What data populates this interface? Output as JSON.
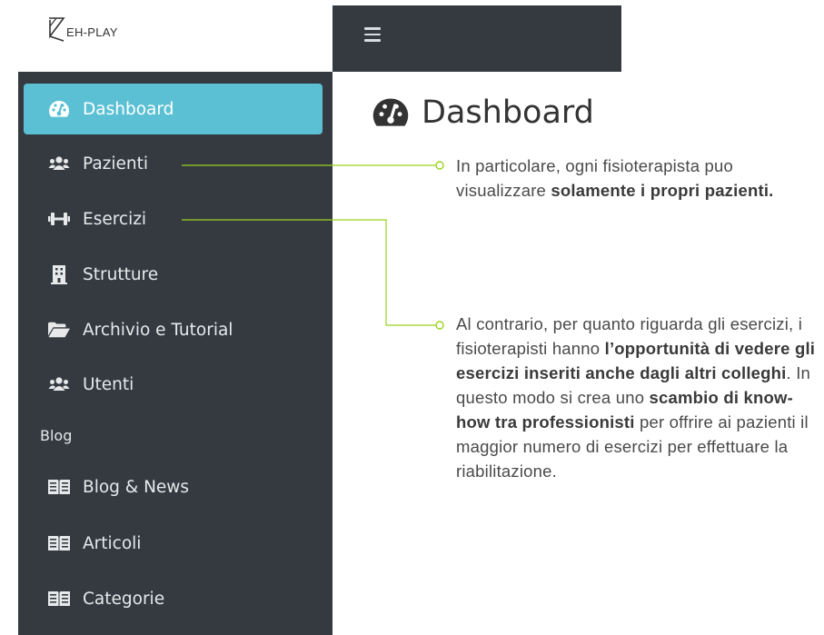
{
  "brand": {
    "logo_text": "EH-PLAY"
  },
  "header": {
    "menu_icon": "hamburger-icon"
  },
  "sidebar": {
    "items": [
      {
        "label": "Dashboard",
        "icon": "dashboard-gauge-icon",
        "active": true
      },
      {
        "label": "Pazienti",
        "icon": "users-icon"
      },
      {
        "label": "Esercizi",
        "icon": "dumbbell-icon"
      },
      {
        "label": "Strutture",
        "icon": "building-icon"
      },
      {
        "label": "Archivio e Tutorial",
        "icon": "folder-open-icon"
      },
      {
        "label": "Utenti",
        "icon": "users-icon"
      }
    ],
    "section_blog": "Blog",
    "blog_items": [
      {
        "label": "Blog & News",
        "icon": "book-open-icon"
      },
      {
        "label": "Articoli",
        "icon": "book-open-icon"
      },
      {
        "label": "Categorie",
        "icon": "book-open-icon"
      }
    ]
  },
  "main": {
    "title": "Dashboard"
  },
  "annotations": {
    "note1": {
      "text_1": "In particolare, ogni fisioterapista puo visualizzare ",
      "bold_1": "solamente i propri pazienti."
    },
    "note2": {
      "text_1": "Al contrario, per quanto riguarda gli esercizi, i fisioterapisti hanno ",
      "bold_1": "l’opportunità di vedere gli esercizi inseriti anche dagli altri colleghi",
      "text_2": ". In questo modo si crea uno ",
      "bold_2": "scambio di know-how tra professionisti",
      "text_3": " per offrire ai pazienti il maggior numero di esercizi per effettuare la riabilitazione."
    }
  },
  "colors": {
    "sidebar_bg": "#343a40",
    "active_bg": "#5bc0d3",
    "connector": "#9bd21e"
  }
}
